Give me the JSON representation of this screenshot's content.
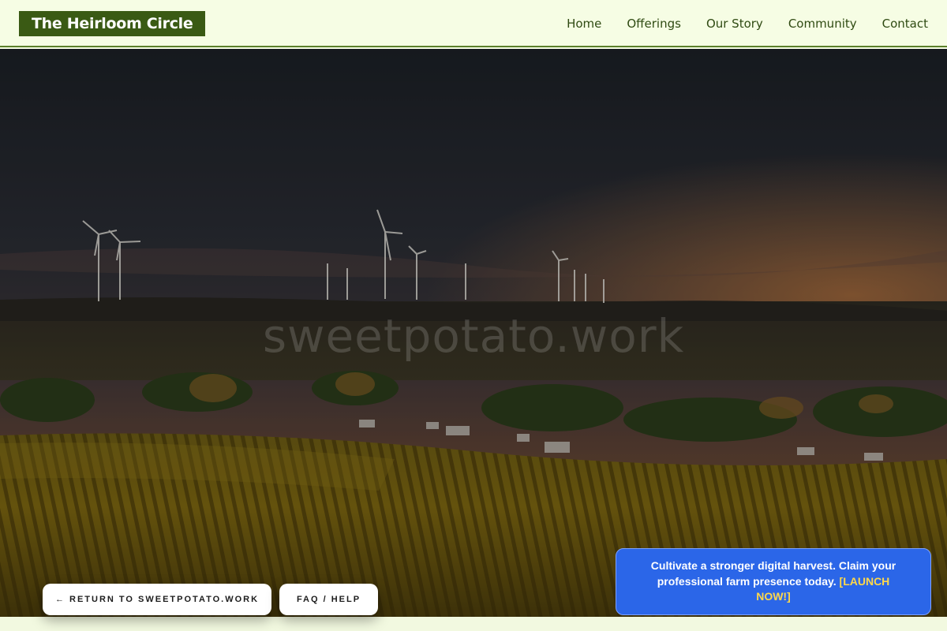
{
  "header": {
    "brand": "The Heirloom Circle",
    "nav": [
      "Home",
      "Offerings",
      "Our Story",
      "Community",
      "Contact"
    ]
  },
  "hero": {
    "watermark": "sweetpotato.work",
    "scene": "dusk-farmland-with-wind-turbines-and-vineyard"
  },
  "buttons": {
    "return_label": "← RETURN TO SWEETPOTATO.WORK",
    "faq_label": "FAQ / HELP"
  },
  "promo": {
    "text": "Cultivate a stronger digital harvest. Claim your professional farm presence today.",
    "cta": "[LAUNCH NOW!]"
  },
  "colors": {
    "brand_bg": "#3a5a14",
    "header_bg": "#f6fde4",
    "promo_bg": "#2b66e8",
    "cta": "#ffd84a"
  }
}
